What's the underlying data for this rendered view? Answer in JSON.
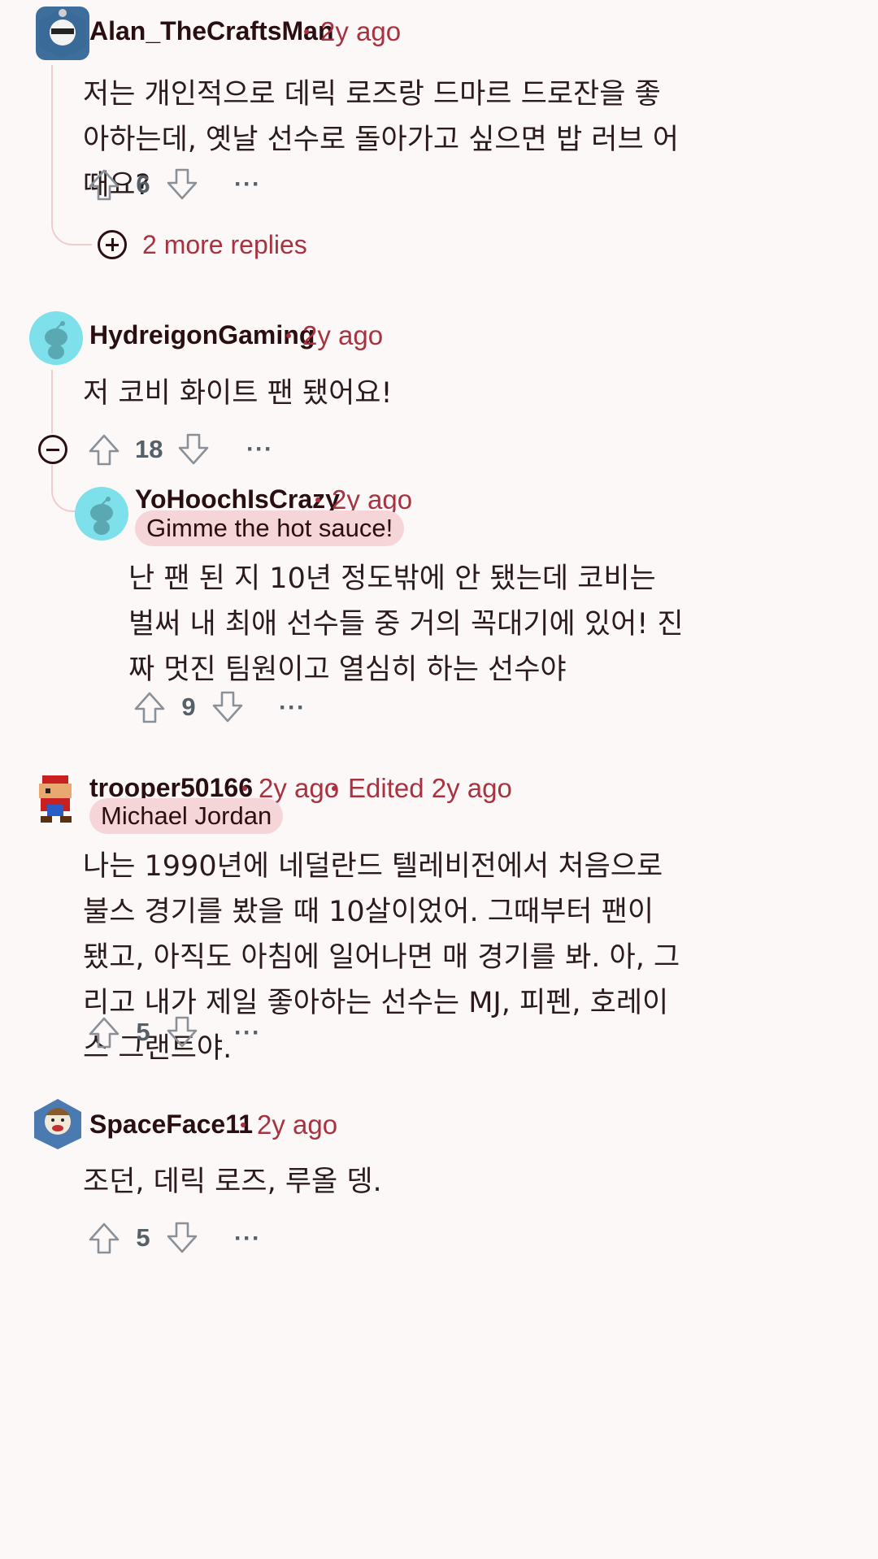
{
  "comments": [
    {
      "username": "Alan_TheCraftsMan",
      "time": "2y ago",
      "body": "저는 개인적으로 데릭 로즈랑 드마르 드로잔을 좋아하는데, 옛날 선수로 돌아가고 싶으면 밥 러브 어때요?",
      "votes": "6",
      "more_replies": "2 more replies"
    },
    {
      "username": "HydreigonGaming",
      "time": "2y ago",
      "body": "저 코비 화이트 팬 됐어요!",
      "votes": "18"
    },
    {
      "username": "YoHoochIsCrazy",
      "time": "2y ago",
      "flair": "Gimme the hot sauce!",
      "body": "난 팬 된 지 10년 정도밖에 안 됐는데 코비는 벌써 내 최애 선수들 중 거의 꼭대기에 있어! 진짜 멋진 팀원이고 열심히 하는 선수야",
      "votes": "9"
    },
    {
      "username": "trooper50166",
      "time": "2y ago",
      "edited": "Edited 2y ago",
      "flair": "Michael Jordan",
      "body": "나는 1990년에 네덜란드 텔레비전에서 처음으로 불스 경기를 봤을 때 10살이었어. 그때부터 팬이 됐고, 아직도 아침에 일어나면 매 경기를 봐. 아, 그리고 내가 제일 좋아하는 선수는 MJ, 피펜, 호레이스 그랜트야.",
      "votes": "5"
    },
    {
      "username": "SpaceFace11",
      "time": "2y ago",
      "body": "조던, 데릭 로즈, 루올 뎅.",
      "votes": "5"
    }
  ],
  "more_options": "···",
  "colors": {
    "accent": "#a83240",
    "background": "#fcf8f8",
    "flair": "#f6d5d8",
    "vote": "#556068"
  },
  "icons": [
    "upvote-icon",
    "downvote-icon",
    "collapse-icon",
    "expand-icon",
    "more-options-icon"
  ]
}
